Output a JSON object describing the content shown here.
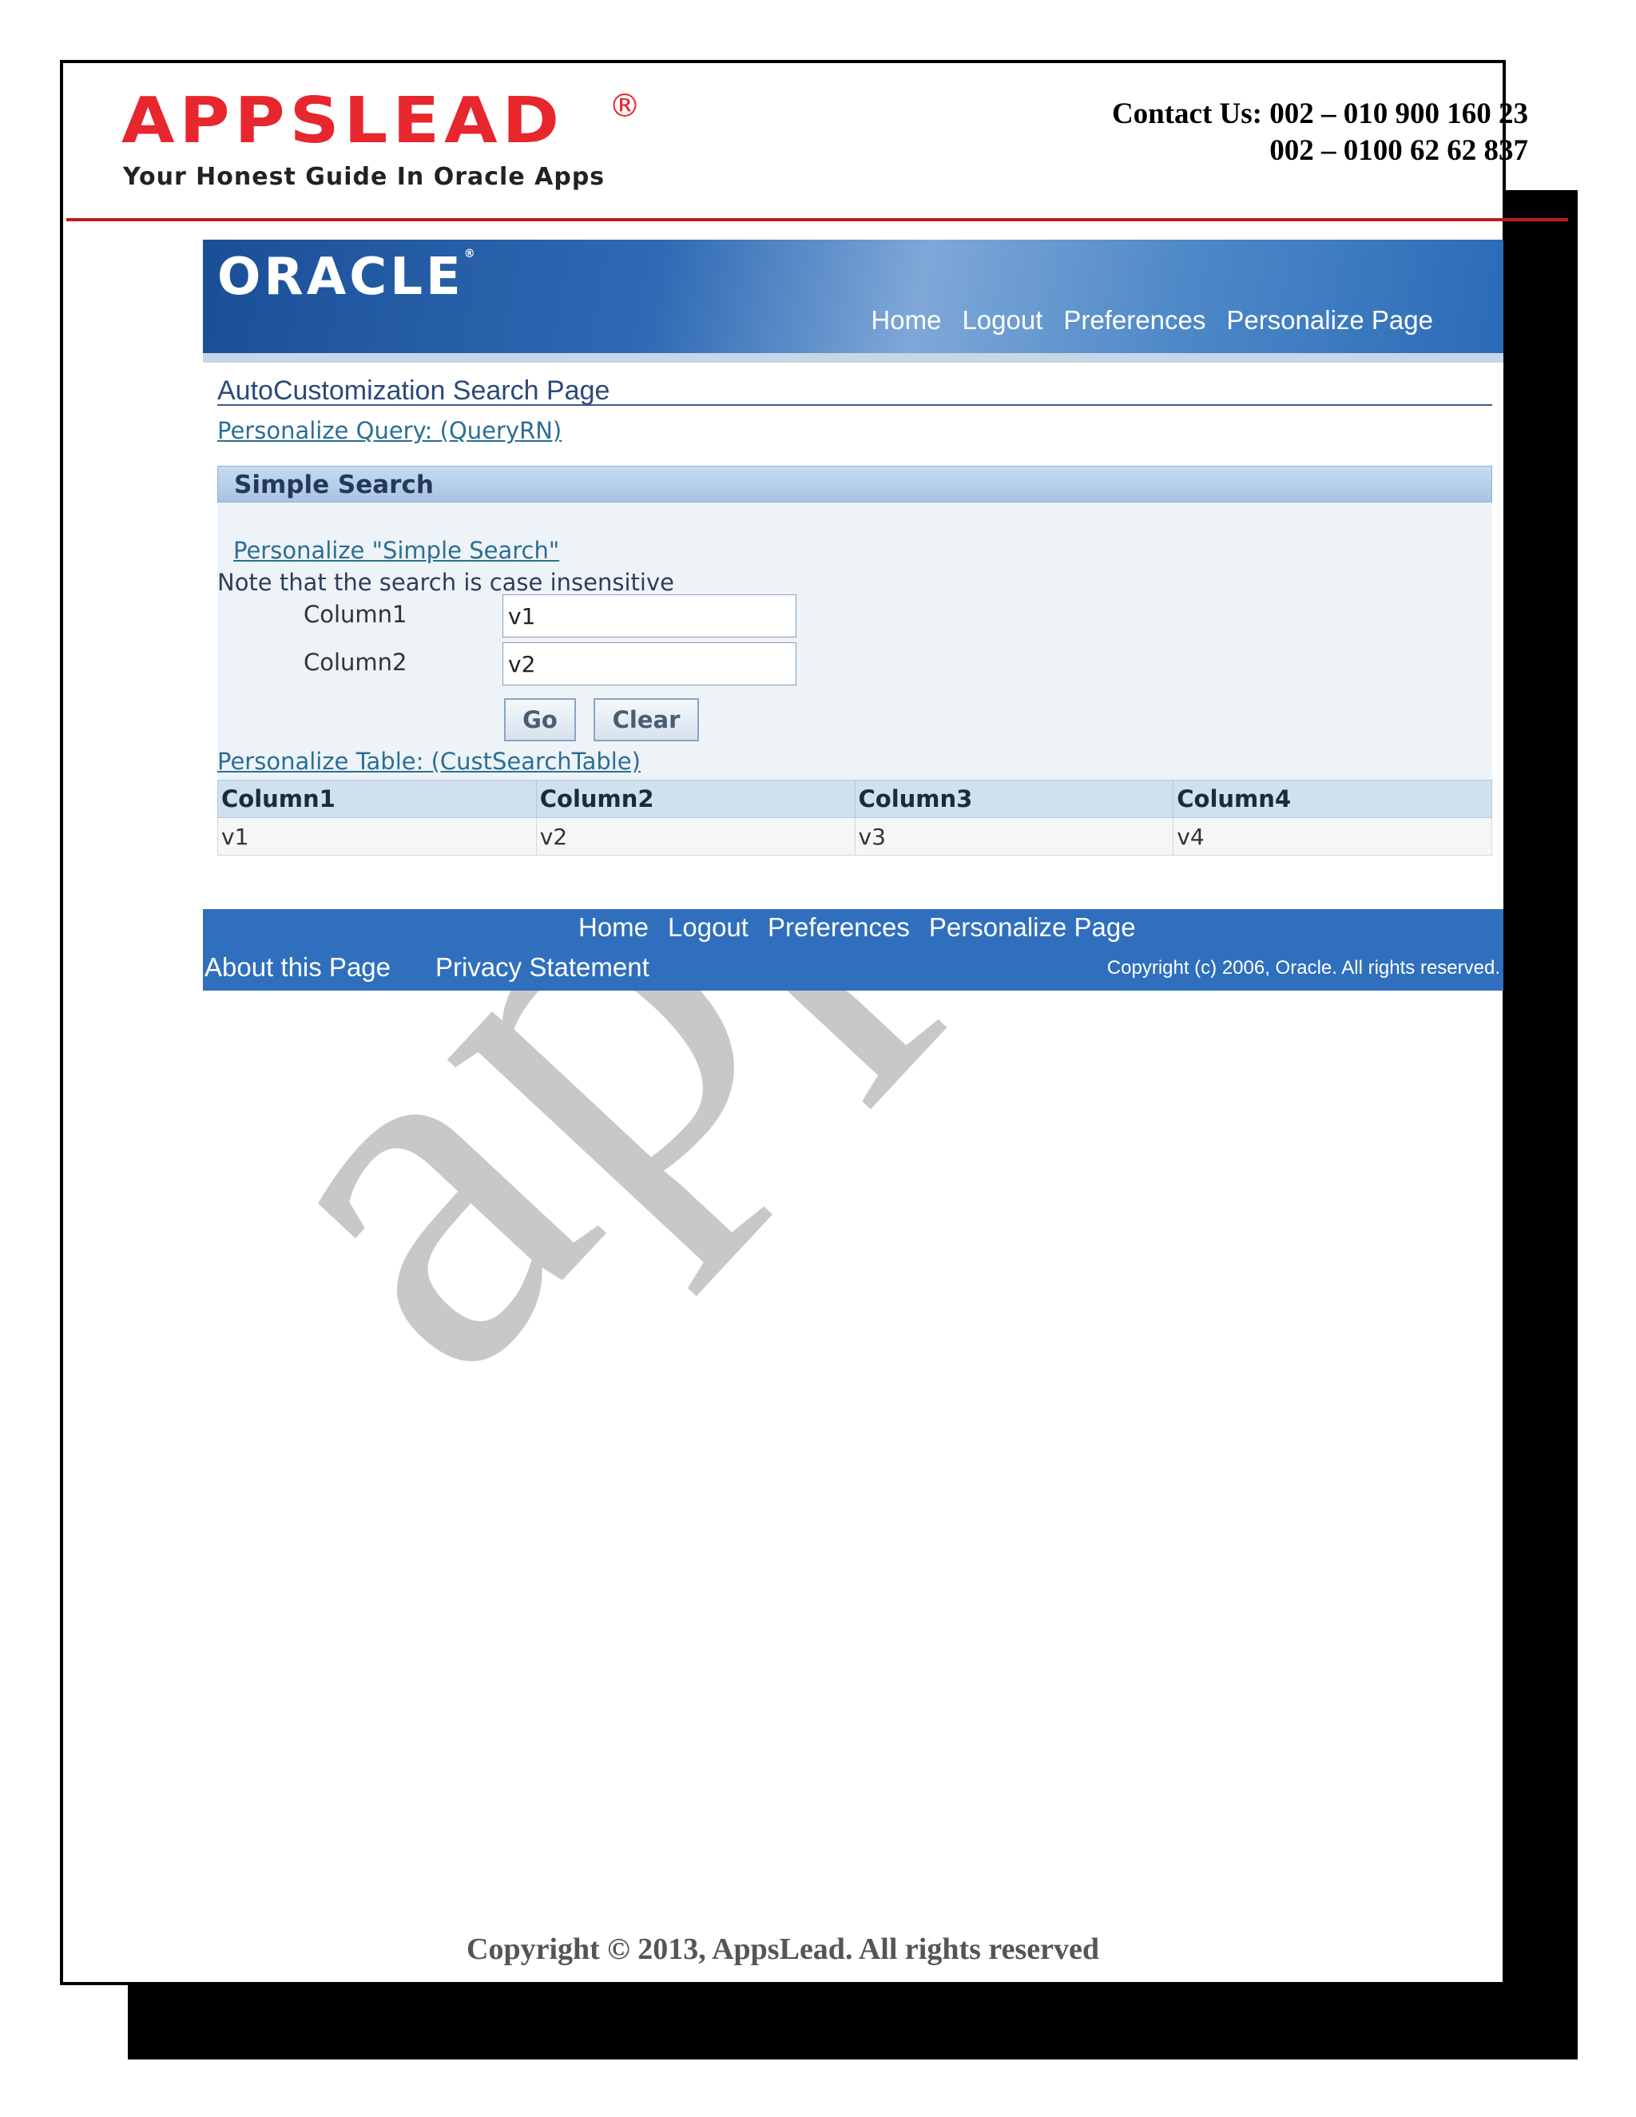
{
  "header": {
    "logo_text": "APPSLEAD",
    "logo_reg": "®",
    "tagline": "Your Honest Guide In Oracle Apps",
    "contact_line1": "Contact Us: 002 – 010 900 160 23",
    "contact_line2": "002 – 0100 62 62 837"
  },
  "oracle": {
    "logo": "ORACLE",
    "global_nav": [
      "Home",
      "Logout",
      "Preferences",
      "Personalize Page"
    ],
    "page_title": "AutoCustomization Search Page",
    "personalize_query": "Personalize Query: (QueryRN)",
    "simple_search": {
      "title": "Simple Search",
      "personalize_link": "Personalize \"Simple Search\"",
      "note": "Note that the search is case insensitive",
      "fields": [
        {
          "label": "Column1",
          "value": "v1"
        },
        {
          "label": "Column2",
          "value": "v2"
        }
      ],
      "go_label": "Go",
      "clear_label": "Clear"
    },
    "personalize_table": "Personalize Table: (CustSearchTable)",
    "table": {
      "headers": [
        "Column1",
        "Column2",
        "Column3",
        "Column4"
      ],
      "rows": [
        [
          "v1",
          "v2",
          "v3",
          "v4"
        ]
      ]
    },
    "footer": {
      "nav": [
        "Home",
        "Logout",
        "Preferences",
        "Personalize Page"
      ],
      "about": "About this Page",
      "privacy": "Privacy Statement",
      "copyright": "Copyright (c) 2006, Oracle. All rights reserved."
    }
  },
  "watermark": "appsl",
  "doc_footer": "Copyright © 2013, AppsLead. All rights reserved",
  "colors": {
    "brand_red": "#e8262d",
    "oracle_blue": "#2f6fbd",
    "link": "#2a6f94"
  }
}
